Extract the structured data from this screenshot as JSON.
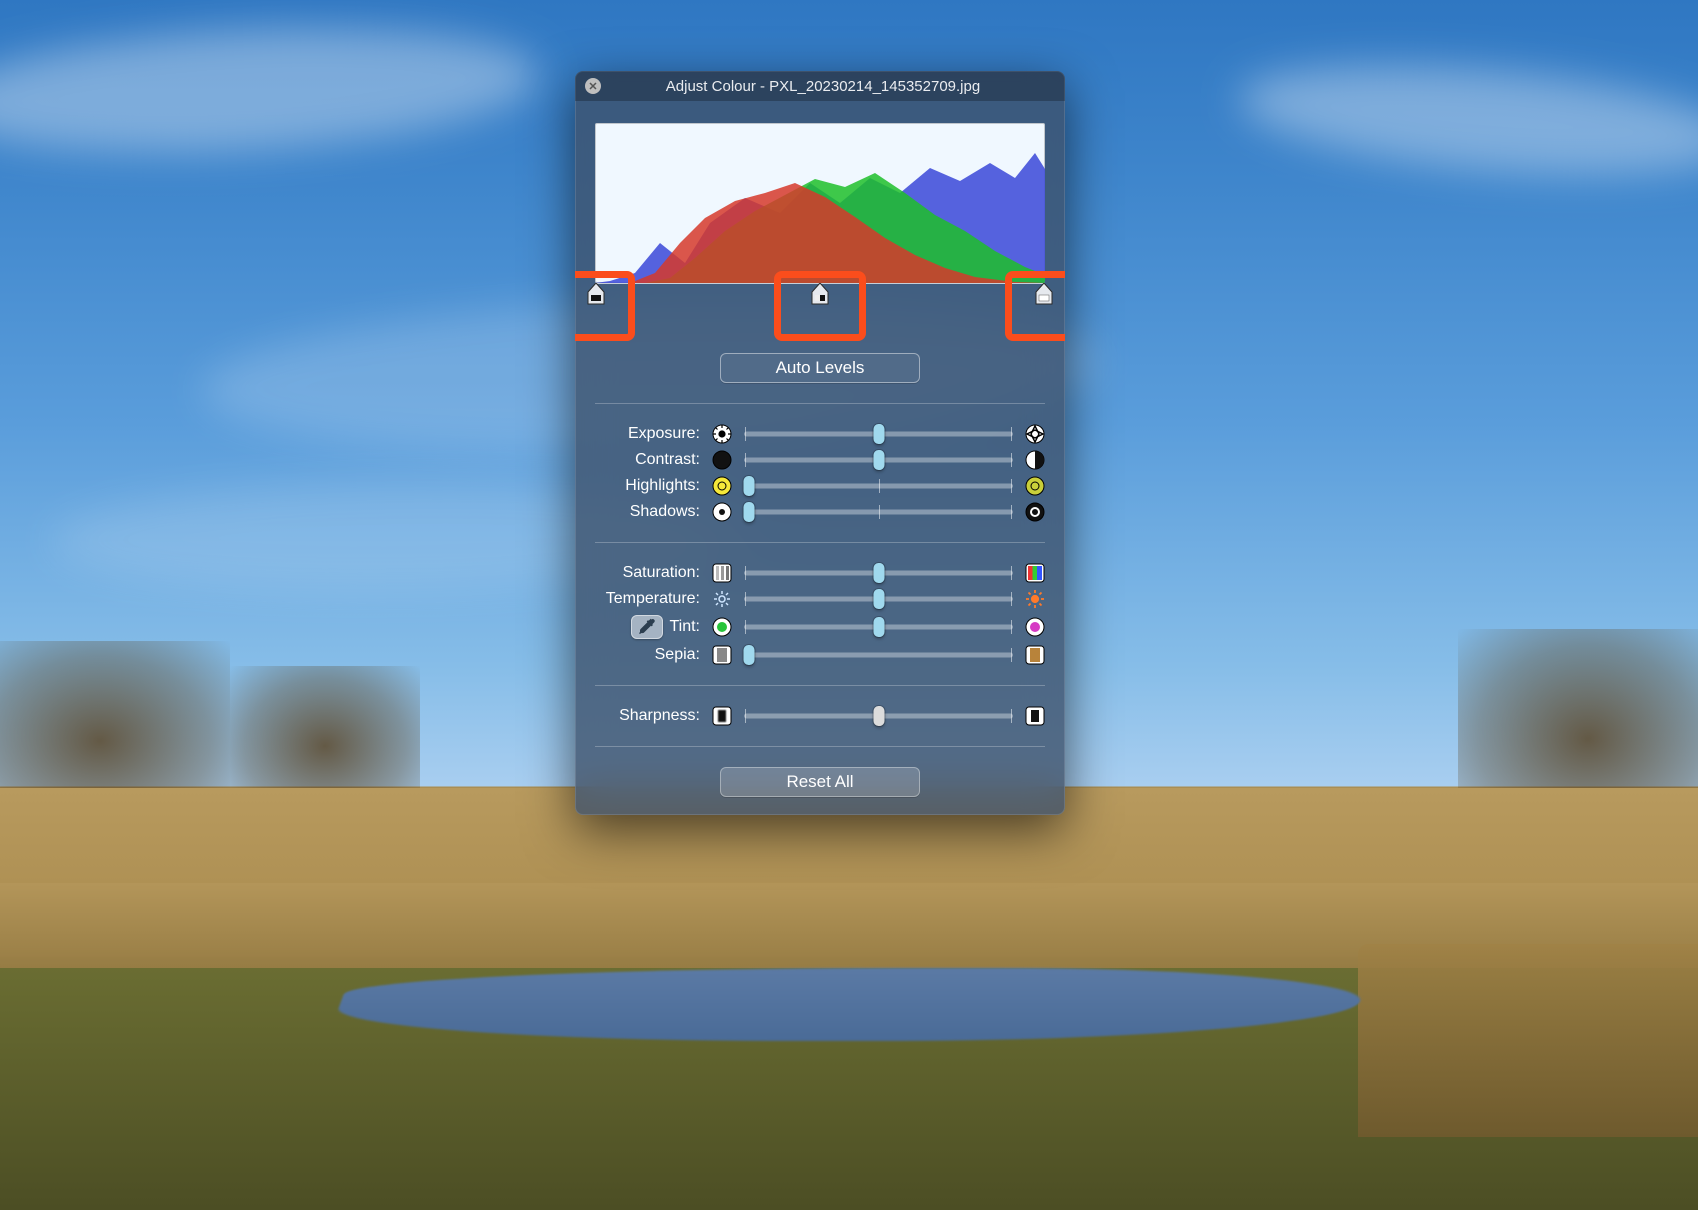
{
  "window": {
    "title": "Adjust Colour - PXL_20230214_145352709.jpg"
  },
  "buttons": {
    "auto_levels": "Auto Levels",
    "reset_all": "Reset All"
  },
  "sliders": {
    "exposure": {
      "label": "Exposure:",
      "value": 50,
      "ticks": "lmr",
      "thumb": "blue"
    },
    "contrast": {
      "label": "Contrast:",
      "value": 50,
      "ticks": "lmr",
      "thumb": "blue"
    },
    "highlights": {
      "label": "Highlights:",
      "value": 2,
      "ticks": "lmr",
      "thumb": "blue"
    },
    "shadows": {
      "label": "Shadows:",
      "value": 2,
      "ticks": "lmr",
      "thumb": "blue"
    },
    "saturation": {
      "label": "Saturation:",
      "value": 50,
      "ticks": "lmr",
      "thumb": "blue"
    },
    "temperature": {
      "label": "Temperature:",
      "value": 50,
      "ticks": "lmr",
      "thumb": "blue"
    },
    "tint": {
      "label": "Tint:",
      "value": 50,
      "ticks": "lmr",
      "thumb": "blue"
    },
    "sepia": {
      "label": "Sepia:",
      "value": 2,
      "ticks": "lr",
      "thumb": "blue"
    },
    "sharpness": {
      "label": "Sharpness:",
      "value": 50,
      "ticks": "lmr",
      "thumb": "grey"
    }
  },
  "levels": {
    "black": 0,
    "mid": 50,
    "white": 100
  },
  "annotations": {
    "highlight_level_handles": true
  }
}
